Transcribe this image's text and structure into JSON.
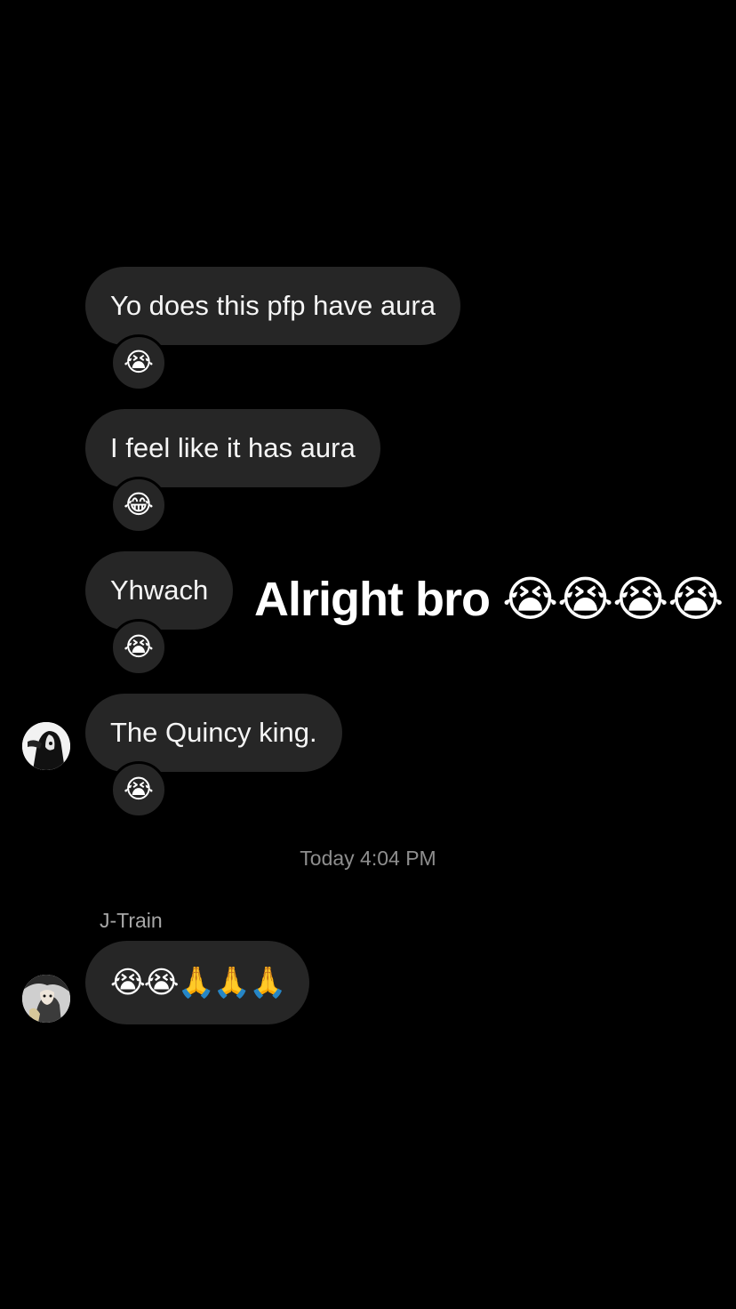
{
  "messages": [
    {
      "text": "Yo does this pfp have aura",
      "reaction": "😭"
    },
    {
      "text": "I feel like it has aura",
      "reaction": "😂"
    },
    {
      "text": "Yhwach",
      "reaction": "😭"
    },
    {
      "text": "The Quincy king.",
      "reaction": "😭"
    }
  ],
  "overlay_caption": "Alright bro 😭😭😭😭",
  "timestamp": "Today 4:04 PM",
  "reply": {
    "sender": "J-Train",
    "text": "😭😭🙏🙏🙏"
  },
  "colors": {
    "background": "#000000",
    "bubble": "#262626",
    "timestamp_text": "#8e8e8e"
  },
  "icons": {
    "avatar_1": "profile-photo-black-white-figure",
    "avatar_2": "profile-photo-anime-character"
  }
}
